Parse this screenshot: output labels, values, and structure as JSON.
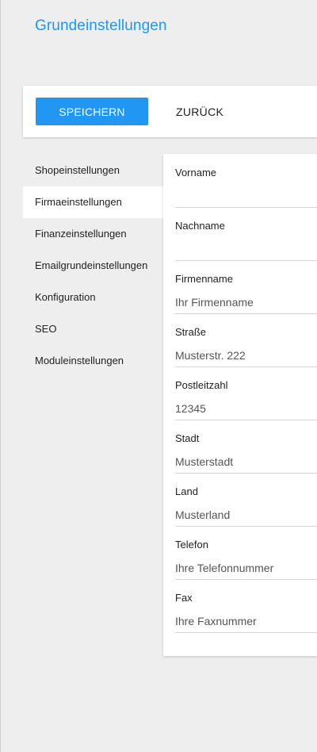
{
  "page": {
    "title": "Grundeinstellungen"
  },
  "toolbar": {
    "save_label": "SPEICHERN",
    "back_label": "ZURÜCK"
  },
  "sidebar": {
    "items": [
      {
        "label": "Shopeinstellungen",
        "active": false
      },
      {
        "label": "Firmaeinstellungen",
        "active": true
      },
      {
        "label": "Finanzeinstellungen",
        "active": false
      },
      {
        "label": "Emailgrundeinstellungen",
        "active": false
      },
      {
        "label": "Konfiguration",
        "active": false
      },
      {
        "label": "SEO",
        "active": false
      },
      {
        "label": "Moduleinstellungen",
        "active": false
      }
    ]
  },
  "form": {
    "fields": [
      {
        "label": "Vorname",
        "value": "",
        "placeholder": ""
      },
      {
        "label": "Nachname",
        "value": "",
        "placeholder": ""
      },
      {
        "label": "Firmenname",
        "value": "",
        "placeholder": "Ihr Firmenname"
      },
      {
        "label": "Straße",
        "value": "",
        "placeholder": "Musterstr. 222"
      },
      {
        "label": "Postleitzahl",
        "value": "",
        "placeholder": "12345"
      },
      {
        "label": "Stadt",
        "value": "",
        "placeholder": "Musterstadt"
      },
      {
        "label": "Land",
        "value": "",
        "placeholder": "Musterland"
      },
      {
        "label": "Telefon",
        "value": "",
        "placeholder": "Ihre Telefonnummer"
      },
      {
        "label": "Fax",
        "value": "",
        "placeholder": "Ihre Faxnummer"
      }
    ]
  },
  "colors": {
    "accent": "#2196f3",
    "background": "#eeeeee",
    "card": "#ffffff"
  }
}
